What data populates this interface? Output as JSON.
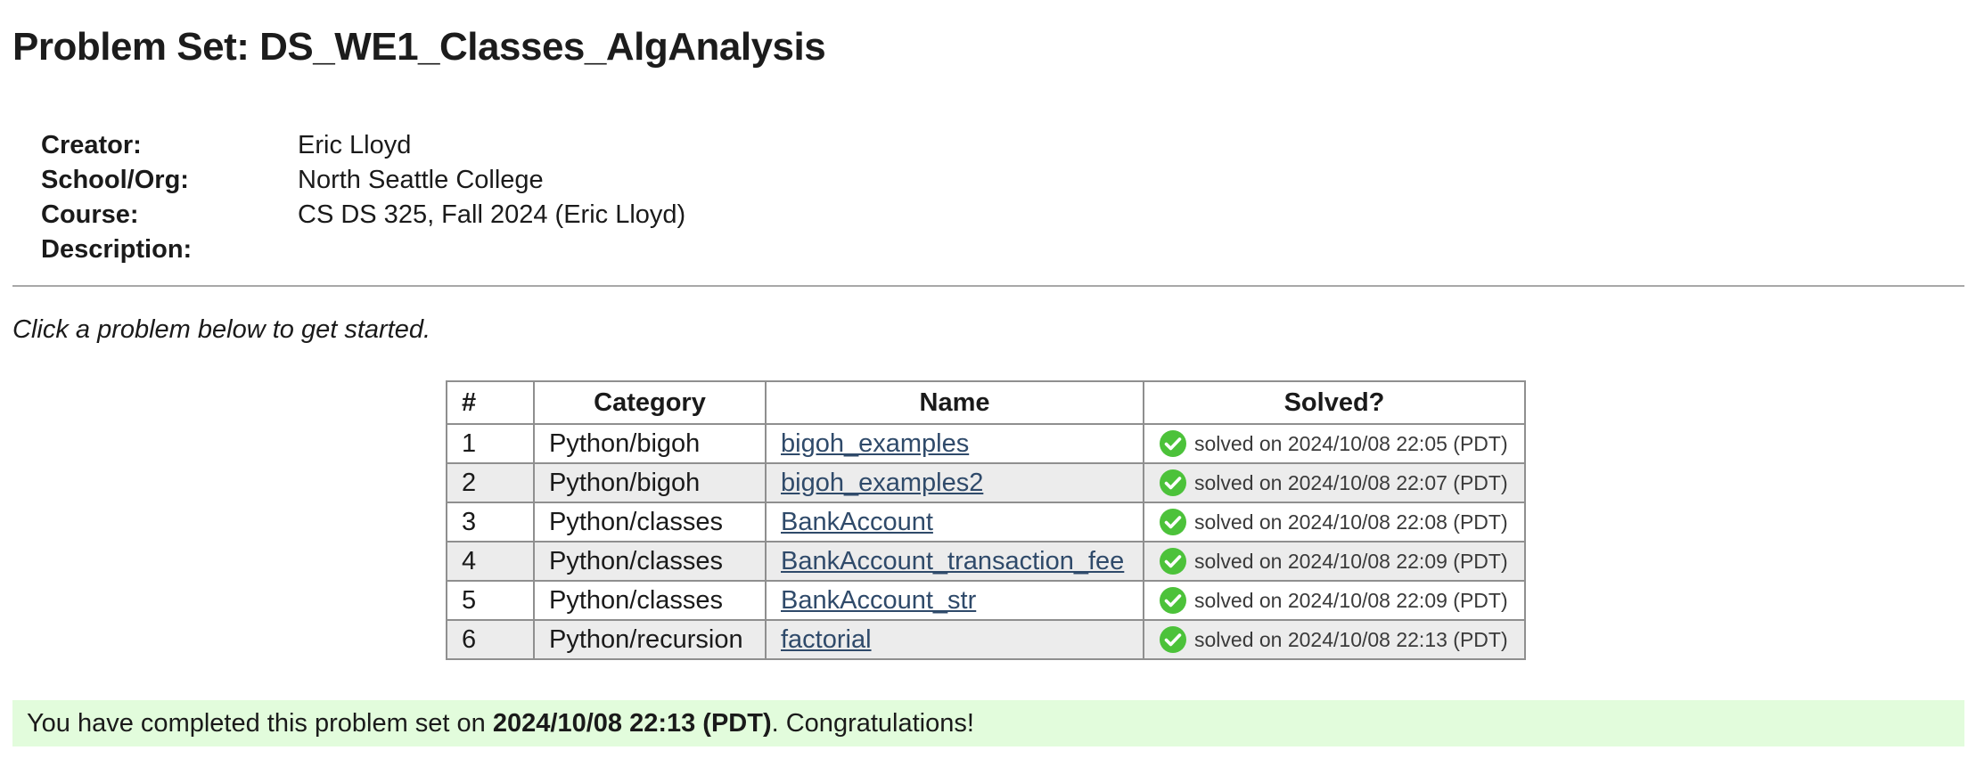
{
  "page": {
    "title": "Problem Set: DS_WE1_Classes_AlgAnalysis"
  },
  "info": [
    {
      "label": "Creator:",
      "value": "Eric Lloyd"
    },
    {
      "label": "School/Org:",
      "value": "North Seattle College"
    },
    {
      "label": "Course:",
      "value": "CS DS 325, Fall 2024 (Eric Lloyd)"
    },
    {
      "label": "Description:",
      "value": ""
    }
  ],
  "intro": "Click a problem below to get started.",
  "table": {
    "headers": [
      "#",
      "Category",
      "Name",
      "Solved?"
    ],
    "rows": [
      {
        "num": "1",
        "category": "Python/bigoh",
        "name": "bigoh_examples",
        "solved": "solved on 2024/10/08 22:05 (PDT)"
      },
      {
        "num": "2",
        "category": "Python/bigoh",
        "name": "bigoh_examples2",
        "solved": "solved on 2024/10/08 22:07 (PDT)"
      },
      {
        "num": "3",
        "category": "Python/classes",
        "name": "BankAccount",
        "solved": "solved on 2024/10/08 22:08 (PDT)"
      },
      {
        "num": "4",
        "category": "Python/classes",
        "name": "BankAccount_transaction_fee",
        "solved": "solved on 2024/10/08 22:09 (PDT)"
      },
      {
        "num": "5",
        "category": "Python/classes",
        "name": "BankAccount_str",
        "solved": "solved on 2024/10/08 22:09 (PDT)"
      },
      {
        "num": "6",
        "category": "Python/recursion",
        "name": "factorial",
        "solved": "solved on 2024/10/08 22:13 (PDT)"
      }
    ]
  },
  "completion": {
    "prefix": "You have completed this problem set on ",
    "date": "2024/10/08 22:13 (PDT)",
    "suffix": ". Congratulations!"
  },
  "icons": {
    "solved": "check-circle-icon"
  },
  "colors": {
    "check": "#4cc23a",
    "link": "#2f4a6a",
    "congrats_bg": "#e2fcdc",
    "alt_row": "#ececec"
  }
}
